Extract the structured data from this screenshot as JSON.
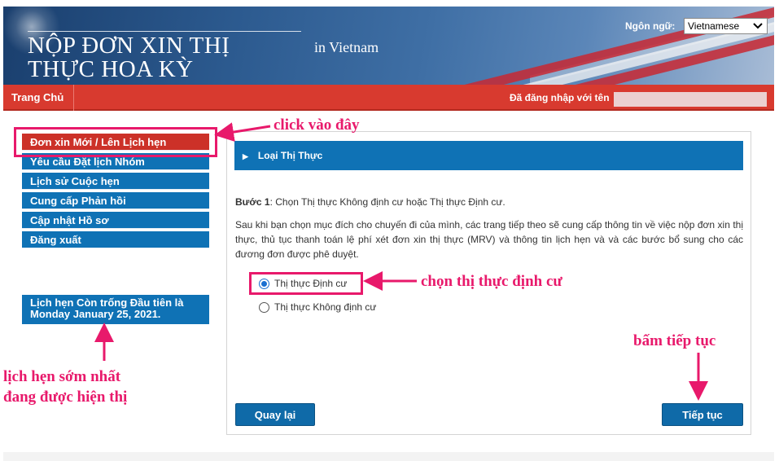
{
  "header": {
    "title": "NỘP ĐƠN XIN THỊ THỰC HOA KỲ",
    "country": "in Vietnam",
    "language_label": "Ngôn ngữ:",
    "language_selected": "Vietnamese"
  },
  "navbar": {
    "home": "Trang Chủ",
    "logged_in": "Đã đăng nhập với tên"
  },
  "sidebar": {
    "items": [
      {
        "label": "Đơn xin Mới / Lên Lịch hẹn",
        "active": true
      },
      {
        "label": "Yêu cầu Đặt lịch Nhóm"
      },
      {
        "label": "Lịch sử Cuộc hẹn"
      },
      {
        "label": "Cung cấp Phản hồi"
      },
      {
        "label": "Cập nhật Hồ sơ"
      },
      {
        "label": "Đăng xuất"
      }
    ],
    "appointment_line1": "Lịch hẹn Còn trống Đầu tiên là",
    "appointment_line2": "Monday January 25, 2021."
  },
  "main": {
    "section_title": "Loại Thị Thực",
    "step_label": "Bước 1",
    "step_text": ": Chọn Thị thực Không định cư hoặc Thị thực Định cư.",
    "description": "Sau khi bạn chọn mục đích cho chuyến đi của mình, các trang tiếp theo sẽ cung cấp thông tin về việc nộp đơn xin thị thực, thủ tục thanh toán lệ phí xét đơn xin thị thực (MRV) và thông tin lịch hẹn và và các bước bổ sung cho các đương đơn được phê duyệt.",
    "options": [
      {
        "label": "Thị thực Định cư",
        "checked": true
      },
      {
        "label": "Thị thực Không định cư",
        "checked": false
      }
    ],
    "back_button": "Quay lại",
    "continue_button": "Tiếp tục"
  },
  "annotations": {
    "click_here": "click vào đây",
    "choose_immigrant": "chọn thị thực định cư",
    "press_continue": "bấm tiếp tục",
    "earliest_line1": "lịch hẹn sớm nhất",
    "earliest_line2": "đang được hiện thị"
  },
  "colors": {
    "nav_red": "#d83a2f",
    "sidebar_blue": "#0f72b5",
    "annotation_pink": "#e8196b"
  }
}
